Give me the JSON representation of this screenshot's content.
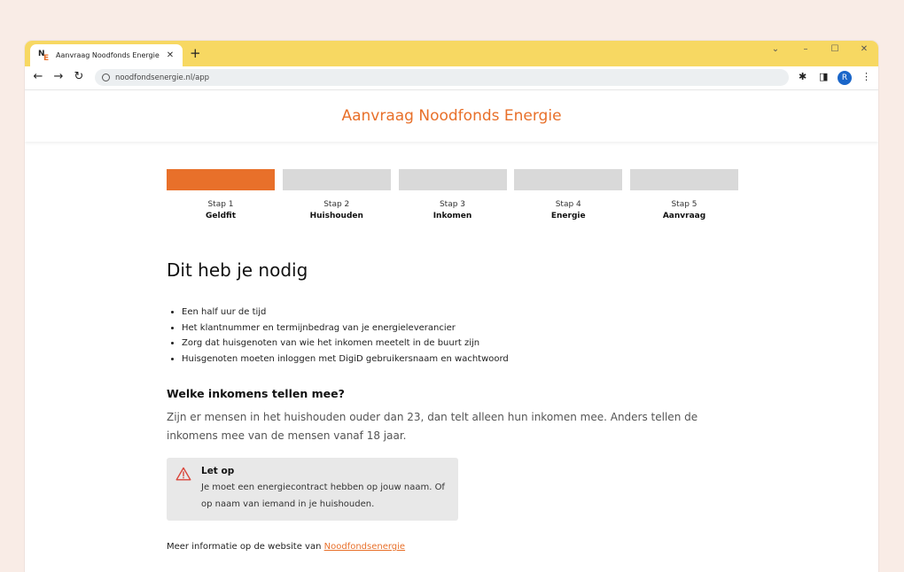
{
  "browser": {
    "tab_title": "Aanvraag Noodfonds Energie",
    "favicon_letters": {
      "n": "N",
      "e": "E"
    },
    "new_tab_glyph": "+",
    "tab_close_glyph": "✕",
    "window_controls": {
      "menu": "⌄",
      "minimize": "–",
      "maximize": "☐",
      "close": "✕"
    },
    "nav": {
      "back": "←",
      "forward": "→",
      "reload": "↻"
    },
    "url": "noodfondsenergie.nl/app",
    "toolbar_icons": {
      "extensions": "✱",
      "sidepanel": "◨",
      "menu": "⋮"
    },
    "avatar_letter": "R"
  },
  "page": {
    "title": "Aanvraag Noodfonds Energie",
    "steps": [
      {
        "num": "Stap 1",
        "name": "Geldfit",
        "active": true
      },
      {
        "num": "Stap 2",
        "name": "Huishouden",
        "active": false
      },
      {
        "num": "Stap 3",
        "name": "Inkomen",
        "active": false
      },
      {
        "num": "Stap 4",
        "name": "Energie",
        "active": false
      },
      {
        "num": "Stap 5",
        "name": "Aanvraag",
        "active": false
      }
    ],
    "heading": "Dit heb je nodig",
    "requirements": [
      "Een half uur de tijd",
      "Het klantnummer en termijnbedrag van je energieleverancier",
      "Zorg dat huisgenoten van wie het inkomen meetelt in de buurt zijn",
      "Huisgenoten moeten inloggen met DigiD gebruikersnaam en wachtwoord"
    ],
    "income_heading": "Welke inkomens tellen mee?",
    "income_text": "Zijn er mensen in het huishouden ouder dan 23, dan telt alleen hun inkomen mee. Anders tellen de inkomens mee van de mensen vanaf 18 jaar.",
    "alert": {
      "title": "Let op",
      "text": "Je moet een energiecontract hebben op jouw naam. Of op naam van iemand in je huishouden."
    },
    "more_info_text": "Meer informatie op de website van ",
    "more_info_link": "Noodfondsenergie"
  },
  "colors": {
    "accent": "#e8702a",
    "tabstrip": "#f7d862",
    "step_inactive": "#d9d9d9",
    "alert_bg": "#e8e8e8",
    "alert_icon": "#d9453a",
    "background": "#f9ece6"
  }
}
